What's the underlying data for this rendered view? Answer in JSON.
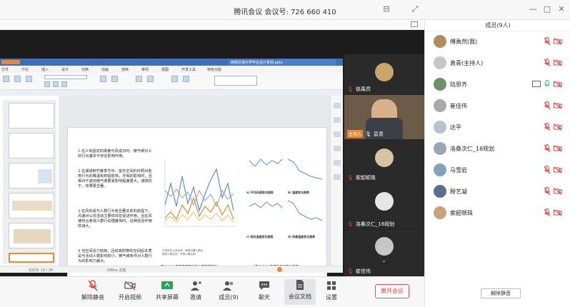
{
  "window": {
    "title": "腾讯会议 会议号: 726 660 410"
  },
  "wps": {
    "menu": [
      "文件",
      "开始",
      "插入",
      "设计",
      "切换",
      "动画",
      "放映",
      "审阅",
      "视图",
      "开发工具",
      "特色功能"
    ],
    "doc_tab": "西南交通大学毕业设计答辩.pptx",
    "status_left": "幻灯片 13 / 20",
    "status_mid": "Office 主题"
  },
  "slide": {
    "bullets": [
      "1.在人有固定的高度与风成日时，微气候对人的行为基本不存在影响作用。",
      "2.在湖城制节度季节中，室外空间的日照对各类行为的降温有积极影响，尽有的影响时，且相对于其他微气候要素影响程度更大，遮阴优于。效果更显著。",
      "3.在风向适与人群行为有显著关系的前提下，风速对公共活动主要体现在促进作用，且在风速较合象观人群行动强度体时，这种促进作用较减大。",
      "4.当空间活力较高，且较高附带的空间后本质是与活动人数影响较小，微气候条件对人群行为的影响力最大。"
    ],
    "chart_left_caption": "图 3.3-1 季节变更下广场人群潮度变化",
    "chart_left_legend": [
      "平时阳光占多比例",
      "秋季中暑人群比",
      "夏季人群比例",
      "冬季人群比例"
    ],
    "chart_right_caption": "图 3.3-2 季节性气候变化趋势",
    "mini_captions": [
      "a) 平均风速变化趋势",
      "b) 温度变化趋势",
      "c) 相对温度变化趋势",
      "d) 体感温度变化趋势"
    ]
  },
  "videos": [
    {
      "name": "徐禹然",
      "role": ""
    },
    {
      "name": "袁青",
      "role": "主持人"
    },
    {
      "name": "索韶顿珠",
      "role": ""
    },
    {
      "name": "洛桑次仁_16规划",
      "role": ""
    },
    {
      "name": "崔佳伟",
      "role": ""
    }
  ],
  "toolbar": {
    "items": [
      {
        "label": "解除静音",
        "icon": "mic-muted-icon"
      },
      {
        "label": "开启视频",
        "icon": "camera-off-icon"
      },
      {
        "label": "共享屏幕",
        "icon": "share-screen-icon"
      },
      {
        "label": "邀请",
        "icon": "invite-icon"
      },
      {
        "label": "成员(9)",
        "icon": "members-icon"
      },
      {
        "label": "聊天",
        "icon": "chat-icon"
      },
      {
        "label": "会议文档",
        "icon": "document-icon"
      },
      {
        "label": "设置",
        "icon": "settings-icon"
      }
    ],
    "leave_label": "离开会议"
  },
  "panel": {
    "title": "成员(9人)",
    "unmute_all": "解除静音",
    "members": [
      {
        "name": "傅禹然(我)",
        "avatar_color": "#b58b5c",
        "mic": "muted",
        "cam": "off"
      },
      {
        "name": "袁青(主持人)",
        "avatar_color": "#c7c7c7",
        "mic": "muted",
        "cam": "off"
      },
      {
        "name": "陆思齐",
        "avatar_color": "#6f8f6a",
        "mic": "on",
        "cam": "screen"
      },
      {
        "name": "崔佳伟",
        "avatar_color": "#a9a9a9",
        "mic": "muted",
        "cam": "off"
      },
      {
        "name": "达平",
        "avatar_color": "#b7c2cc",
        "mic": "muted",
        "cam": "off"
      },
      {
        "name": "洛桑次仁_16规划",
        "avatar_color": "#9aa6b2",
        "mic": "muted",
        "cam": "off"
      },
      {
        "name": "马雪岩",
        "avatar_color": "#7fa3b8",
        "mic": "muted",
        "cam": "off"
      },
      {
        "name": "穆艺凝",
        "avatar_color": "#5a6f8a",
        "mic": "muted",
        "cam": "off"
      },
      {
        "name": "索韶顿珠",
        "avatar_color": "#c9a27a",
        "mic": "muted",
        "cam": "off"
      }
    ]
  },
  "colors": {
    "muted_red": "#e04040",
    "mic_green": "#3db86a",
    "wps_blue": "#3e6fb7"
  }
}
